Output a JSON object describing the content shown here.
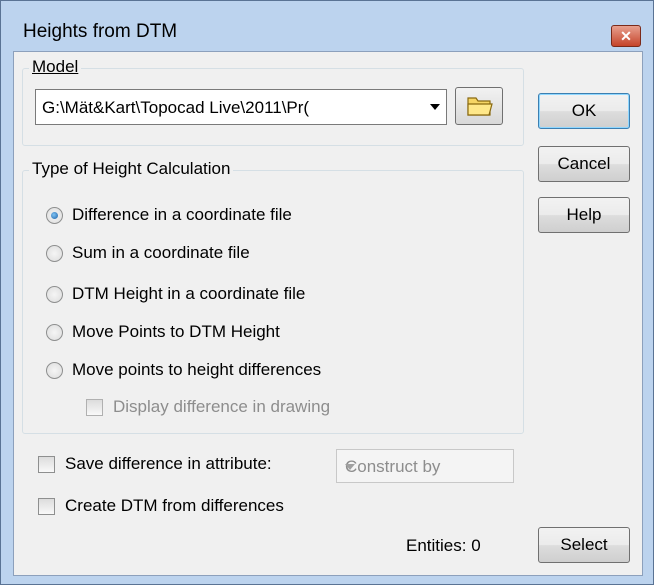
{
  "window": {
    "title": "Heights from DTM",
    "close_icon": "close-icon"
  },
  "model": {
    "group_label": "Model",
    "path_value": "G:\\Mät&Kart\\Topocad Live\\2011\\Pr(",
    "browse_icon": "folder-icon"
  },
  "buttons": {
    "ok": "OK",
    "cancel": "Cancel",
    "help": "Help",
    "select": "Select"
  },
  "height_calc": {
    "group_label": "Type of Height Calculation",
    "options": [
      {
        "label": "Difference in a  coordinate file",
        "checked": true
      },
      {
        "label": "Sum in a  coordinate file",
        "checked": false
      },
      {
        "label": "DTM Height in a  coordinate file",
        "checked": false
      },
      {
        "label": "Move Points to DTM Height",
        "checked": false
      },
      {
        "label": "Move points to height differences",
        "checked": false
      }
    ],
    "display_difference_label": "Display difference in drawing"
  },
  "options": {
    "save_difference_label": "Save difference in attribute:",
    "attribute_select_value": "Construct by",
    "create_dtm_label": "Create DTM from differences"
  },
  "status": {
    "entities": "Entities: 0"
  }
}
